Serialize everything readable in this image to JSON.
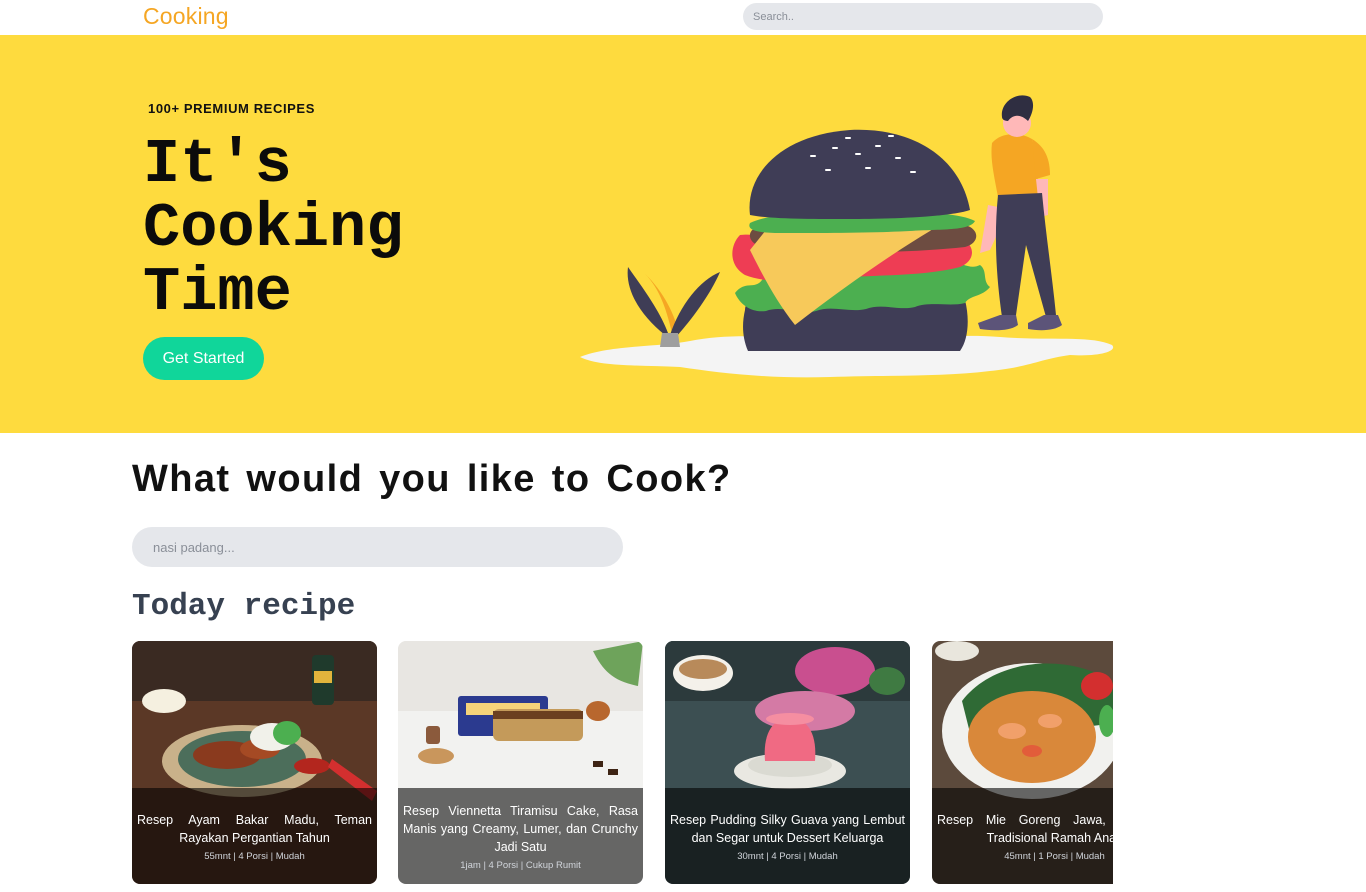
{
  "nav": {
    "brand": "Cooking",
    "search_placeholder": "Search.."
  },
  "hero": {
    "eyebrow": "100+ PREMIUM RECIPES",
    "title_lines": [
      "It's",
      "Cooking",
      "Time"
    ],
    "cta_label": "Get Started"
  },
  "main": {
    "heading": "What would you like to Cook?",
    "search_placeholder": "nasi padang...",
    "section_title": "Today recipe"
  },
  "recipes": [
    {
      "title": "Resep Ayam Bakar Madu, Teman Rayakan Pergantian Tahun",
      "meta": "55mnt | 4 Porsi | Mudah"
    },
    {
      "title": "Resep Viennetta Tiramisu Cake, Rasa Manis yang Creamy, Lumer, dan Crunchy Jadi Satu",
      "meta": "1jam | 4 Porsi | Cukup Rumit"
    },
    {
      "title": "Resep Pudding Silky Guava yang Lembut dan Segar untuk Dessert Keluarga",
      "meta": "30mnt | 4 Porsi | Mudah"
    },
    {
      "title": "Resep Mie Goreng Jawa, Hidangan Tradisional Ramah Anak",
      "meta": "45mnt | 1 Porsi | Mudah"
    }
  ],
  "colors": {
    "brand": "#f5a623",
    "hero_bg": "#fedb3e",
    "cta": "#10d69a",
    "search_bg": "#e5e7eb"
  }
}
